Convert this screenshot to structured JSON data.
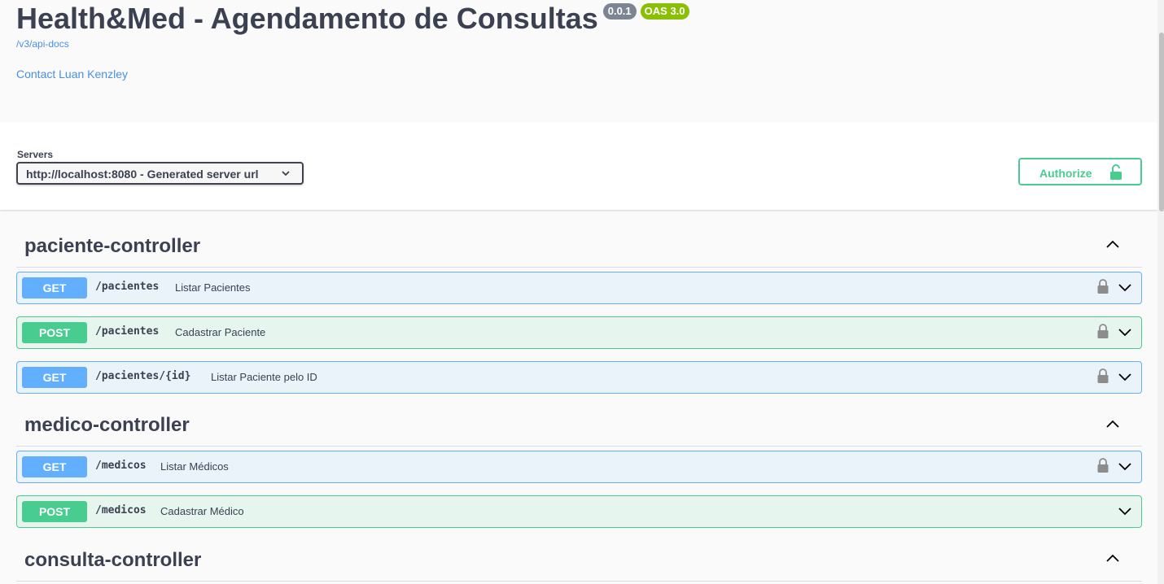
{
  "info": {
    "title": "Health&Med - Agendamento de Consultas",
    "version": "0.0.1",
    "oas": "OAS 3.0",
    "api_docs_link": "/v3/api-docs",
    "contact": "Contact Luan Kenzley"
  },
  "servers": {
    "label": "Servers",
    "selected": "http://localhost:8080 - Generated server url"
  },
  "authorize_label": "Authorize",
  "sections": [
    {
      "name": "paciente-controller",
      "operations": [
        {
          "method": "GET",
          "path": "/pacientes",
          "summary": "Listar Pacientes",
          "locked": true
        },
        {
          "method": "POST",
          "path": "/pacientes",
          "summary": "Cadastrar Paciente",
          "locked": true
        },
        {
          "method": "GET",
          "path": "/pacientes/{id}",
          "summary": "Listar Paciente pelo ID",
          "locked": true
        }
      ]
    },
    {
      "name": "medico-controller",
      "operations": [
        {
          "method": "GET",
          "path": "/medicos",
          "summary": "Listar Médicos",
          "locked": true
        },
        {
          "method": "POST",
          "path": "/medicos",
          "summary": "Cadastrar Médico",
          "locked": false
        }
      ]
    },
    {
      "name": "consulta-controller",
      "operations": []
    }
  ],
  "colors": {
    "get": "#61affe",
    "post": "#49cc90",
    "link": "#4990e2",
    "version_badge": "#7d8492",
    "oas_badge": "#89bf04"
  }
}
